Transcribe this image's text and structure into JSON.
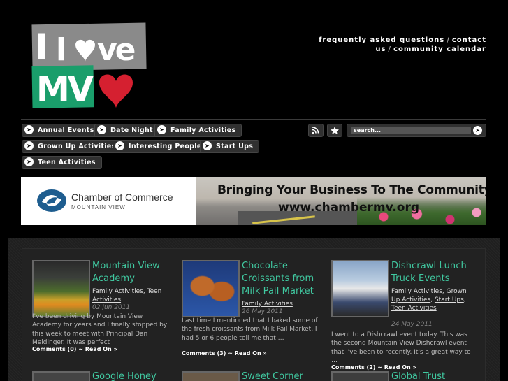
{
  "logo": {
    "line1": "I love",
    "line2": "MV",
    "colors": {
      "green": "#1a9e6b",
      "red": "#d52030",
      "gray": "#8a8a8a"
    }
  },
  "topnav": {
    "faq": "frequently asked questions",
    "contact": "contact us",
    "calendar": "community calendar"
  },
  "categories": {
    "annual_events": "Annual Events",
    "date_night": "Date Night",
    "family_activities": "Family Activities",
    "grown_up_activities": "Grown Up Activities",
    "interesting_people": "Interesting People",
    "start_ups": "Start Ups",
    "teen_activities": "Teen Activities"
  },
  "search": {
    "placeholder": "search..."
  },
  "banner": {
    "org": "Chamber of Commerce",
    "org_sub": "MOUNTAIN VIEW",
    "headline": "Bringing Your Business To The Community",
    "url": "www.chambermv.org"
  },
  "posts": [
    {
      "title": "Mountain View Academy",
      "cats": [
        "Family Activities",
        "Teen Activities"
      ],
      "date": "02 Jun 2011",
      "excerpt": "I've been driving by Mountain View Academy for years and I finally stopped by this week to meet with Principal Dan Meidinger. It was perfect …",
      "comments": "Comments (0)",
      "read_more": "Read On »"
    },
    {
      "title": "Chocolate Croissants from Milk Pail Market",
      "cats": [
        "Family Activities"
      ],
      "date": "26 May 2011",
      "excerpt": "Last time I mentioned that I baked some of the fresh croissants from Milk Pail Market, I had 5 or 6 people tell me that …",
      "comments": "Comments (3)",
      "read_more": "Read On »"
    },
    {
      "title": "Dishcrawl Lunch Truck Events",
      "cats": [
        "Family Activities",
        "Grown Up Activities",
        "Start Ups",
        "Teen Activities"
      ],
      "date": "24 May 2011",
      "excerpt": "I went to a Dishcrawl event today. This was the second Mountain View Dishcrawl event that I've been to recently. It's a great way to …",
      "comments": "Comments (2)",
      "read_more": "Read On »"
    }
  ],
  "next_posts": [
    "Google Honey",
    "Sweet Corner",
    "Global Trust"
  ],
  "meta_sep": "~",
  "icons": {
    "rss": "rss-icon",
    "star": "star-icon",
    "arrow": "arrow-right-icon"
  }
}
